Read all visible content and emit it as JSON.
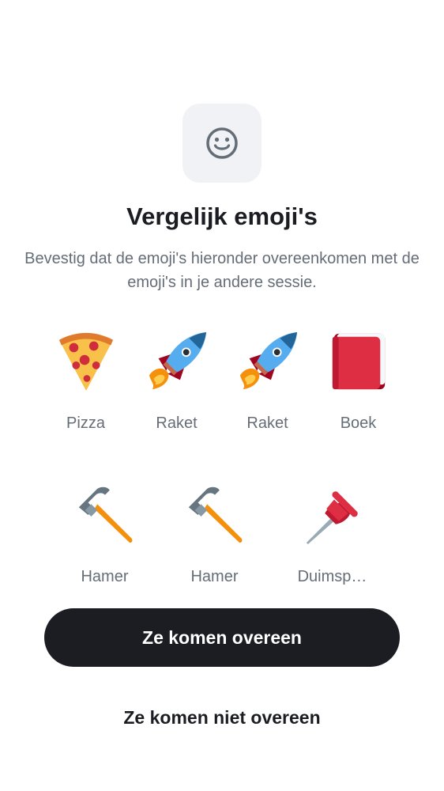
{
  "header": {
    "icon": "smiley-face-icon",
    "title": "Vergelijk emoji's",
    "description": "Bevestig dat de emoji's hieronder overeenkomen met de emoji's in je andere sessie."
  },
  "emojis": [
    {
      "icon": "pizza-icon",
      "label": "Pizza"
    },
    {
      "icon": "rocket-icon",
      "label": "Raket"
    },
    {
      "icon": "rocket-icon",
      "label": "Raket"
    },
    {
      "icon": "book-icon",
      "label": "Boek"
    },
    {
      "icon": "hammer-icon",
      "label": "Hamer"
    },
    {
      "icon": "hammer-icon",
      "label": "Hamer"
    },
    {
      "icon": "pushpin-icon",
      "label": "Duimsp…"
    }
  ],
  "actions": {
    "confirm_label": "Ze komen overeen",
    "deny_label": "Ze komen niet overeen"
  }
}
